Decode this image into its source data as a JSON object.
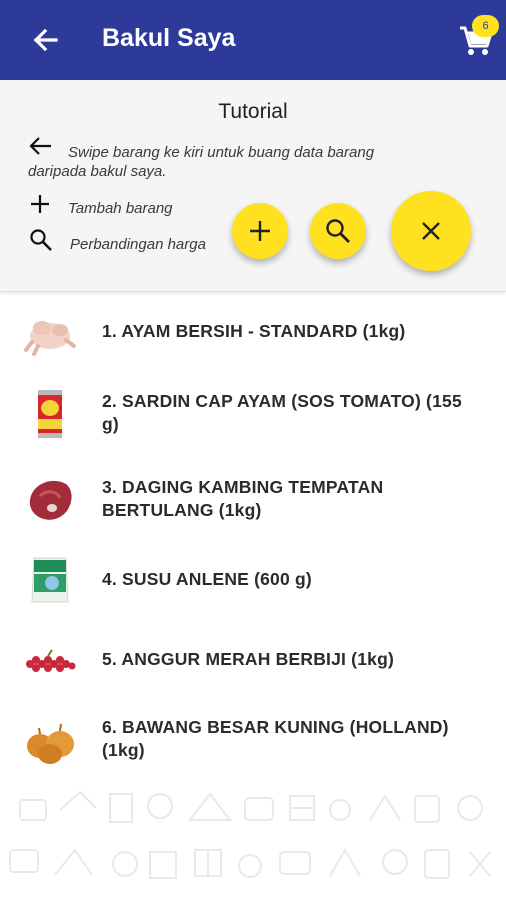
{
  "header": {
    "title": "Bakul Saya",
    "cart_count": "6"
  },
  "tutorial": {
    "title": "Tutorial",
    "swipe_text_line1": "Swipe barang ke kiri untuk buang data barang",
    "swipe_text_line2": "daripada bakul saya.",
    "add_text": "Tambah barang",
    "compare_text": "Perbandingan harga"
  },
  "items": [
    {
      "line1": "1. AYAM BERSIH - STANDARD (1kg)",
      "line2": "",
      "image": "chicken"
    },
    {
      "line1": "2. SARDIN CAP AYAM (SOS TOMATO) (155",
      "line2": "g)",
      "image": "sardine-can"
    },
    {
      "line1": "3. DAGING KAMBING TEMPATAN",
      "line2": "BERTULANG (1kg)",
      "image": "mutton"
    },
    {
      "line1": "4. SUSU ANLENE (600 g)",
      "line2": "",
      "image": "milk-pack"
    },
    {
      "line1": "5. ANGGUR MERAH BERBIJI (1kg)",
      "line2": "",
      "image": "grapes"
    },
    {
      "line1": "6. BAWANG BESAR KUNING (HOLLAND)",
      "line2": "(1kg)",
      "image": "onions"
    }
  ],
  "icons": {
    "back": "arrow-left-icon",
    "cart": "cart-icon",
    "add": "plus-icon",
    "search": "search-icon",
    "close": "close-icon"
  },
  "colors": {
    "appbar": "#2d3a9a",
    "accent": "#ffe11f",
    "text": "#2b2b2b"
  }
}
